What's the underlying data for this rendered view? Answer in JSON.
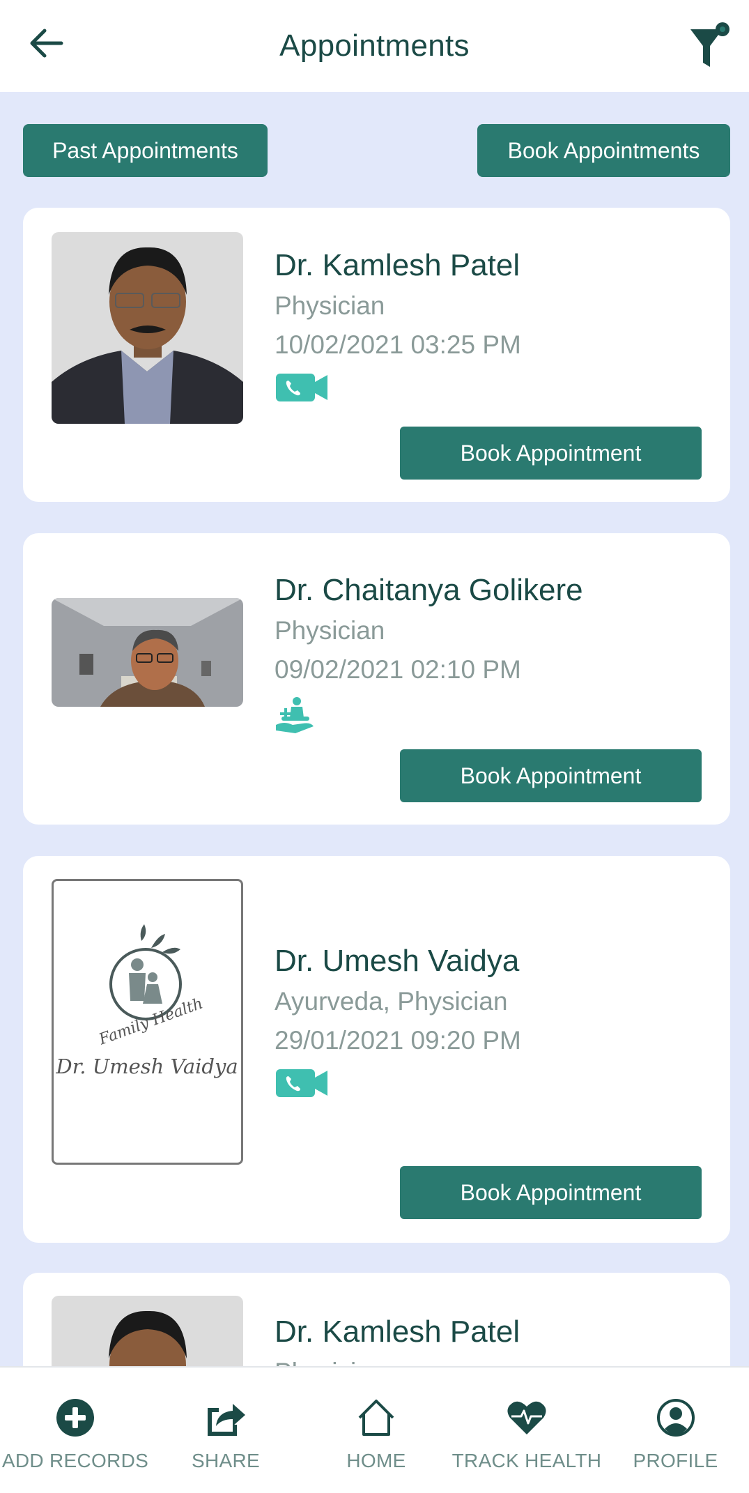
{
  "header": {
    "title": "Appointments",
    "back_icon": "arrow-left-icon",
    "filter_icon": "filter-icon"
  },
  "actions": {
    "past_label": "Past Appointments",
    "book_label": "Book Appointments"
  },
  "colors": {
    "primary": "#2a7a70",
    "title": "#1b4a46",
    "muted": "#8a9a98",
    "background": "#e2e8fa",
    "icon_accent": "#3fbfb0"
  },
  "appointments": [
    {
      "name": "Dr. Kamlesh Patel",
      "specialty": "Physician",
      "datetime": "10/02/2021 03:25 PM",
      "mode_icon": "video-call-icon",
      "button": "Book Appointment"
    },
    {
      "name": "Dr. Chaitanya Golikere",
      "specialty": "Physician",
      "datetime": "09/02/2021 02:10 PM",
      "mode_icon": "in-clinic-icon",
      "button": "Book Appointment"
    },
    {
      "name": "Dr. Umesh Vaidya",
      "specialty": "Ayurveda, Physician",
      "datetime": "29/01/2021 09:20 PM",
      "mode_icon": "video-call-icon",
      "button": "Book Appointment",
      "logo_text": "Family Health",
      "logo_name": "Dr. Umesh Vaidya"
    },
    {
      "name": "Dr. Kamlesh Patel",
      "specialty": "Physician"
    }
  ],
  "nav": [
    {
      "label": "ADD RECORDS",
      "icon": "add-circle-icon"
    },
    {
      "label": "SHARE",
      "icon": "share-icon"
    },
    {
      "label": "HOME",
      "icon": "home-icon"
    },
    {
      "label": "TRACK HEALTH",
      "icon": "heartbeat-icon"
    },
    {
      "label": "PROFILE",
      "icon": "profile-icon"
    }
  ]
}
